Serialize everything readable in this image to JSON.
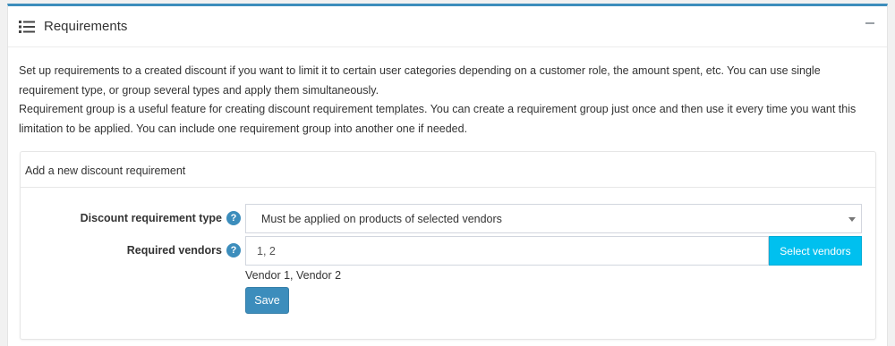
{
  "panel": {
    "title": "Requirements",
    "title_icon": "list-icon",
    "collapse_icon": "minus-icon"
  },
  "description": {
    "line1": "Set up requirements to a created discount if you want to limit it to certain user categories depending on a customer role, the amount spent, etc. You can use single",
    "line2": "requirement type, or group several types and apply them simultaneously.",
    "line3": "Requirement group is a useful feature for creating discount requirement templates. You can create a requirement group just once and then use it every time you want this",
    "line4": "limitation to be applied. You can include one requirement group into another one if needed."
  },
  "card": {
    "title": "Add a new discount requirement",
    "type_label": "Discount requirement type",
    "type_value": "Must be applied on products of selected vendors",
    "vendors_label": "Required vendors",
    "vendors_value": "1, 2",
    "select_vendors_label": "Select vendors",
    "vendor_names": "Vendor 1, Vendor 2",
    "save_label": "Save",
    "help_glyph": "?"
  },
  "colors": {
    "accent": "#3c8dbc",
    "info": "#00c0ef"
  }
}
